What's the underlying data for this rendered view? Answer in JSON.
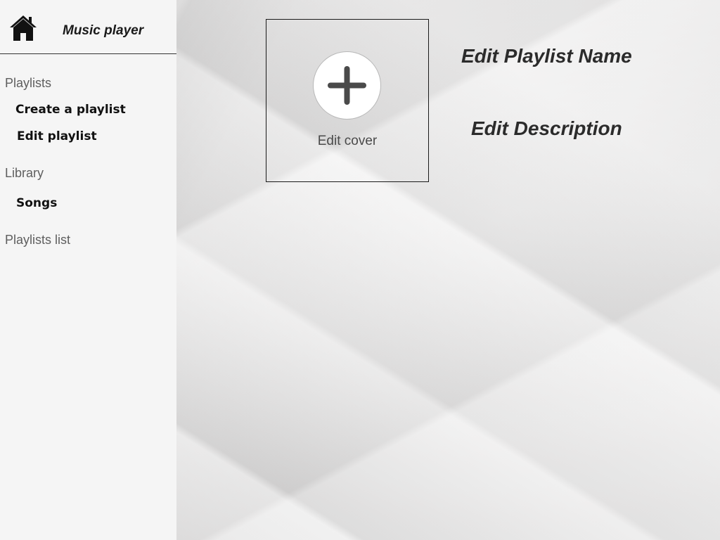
{
  "sidebar": {
    "header": {
      "home_icon": "home-icon",
      "app_title": "Music player"
    },
    "sections": {
      "playlists_label": "Playlists",
      "create_playlist": "Create a playlist",
      "edit_playlist": "Edit playlist",
      "library_label": "Library",
      "songs": "Songs",
      "playlists_list": "Playlists list"
    }
  },
  "main": {
    "cover": {
      "icon": "plus-icon",
      "label": "Edit cover"
    },
    "playlist_name_placeholder": "Edit Playlist Name",
    "description_placeholder": "Edit Description"
  },
  "colors": {
    "sidebar_bg": "#f5f5f5",
    "text_dark": "#111111",
    "text_muted": "#5e5e5e",
    "plus_icon": "#4a4a4a"
  }
}
